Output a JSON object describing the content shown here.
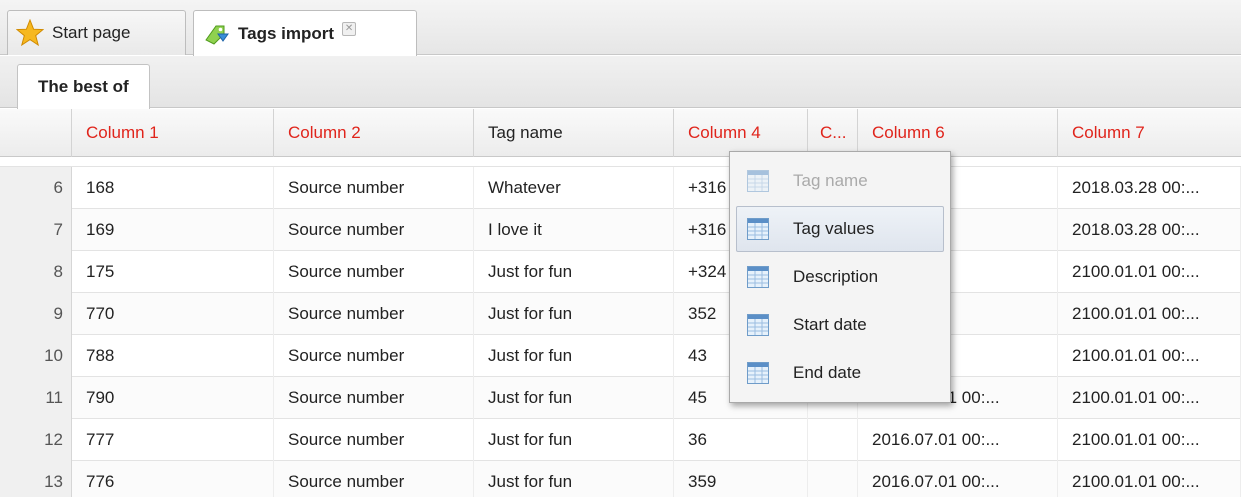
{
  "tabs": [
    {
      "label": "Start page",
      "icon": "star-icon",
      "active": false
    },
    {
      "label": "Tags import",
      "icon": "tags-import-icon",
      "active": true,
      "closable": true
    }
  ],
  "subtab": {
    "label": "The best of"
  },
  "grid": {
    "columns": [
      "",
      "Column 1",
      "Column 2",
      "Tag name",
      "Column 4",
      "C...",
      "Column 6",
      "Column 7"
    ],
    "column_colors": {
      "mapped": "#222222",
      "unmapped": "#e0241b"
    },
    "rows": [
      [
        "6",
        "168",
        "Source number",
        "Whatever",
        "+316",
        "",
        ".01 00:...",
        "2018.03.28 00:..."
      ],
      [
        "7",
        "169",
        "Source number",
        "I love it",
        "+316",
        "",
        ".01 00:...",
        "2018.03.28 00:..."
      ],
      [
        "8",
        "175",
        "Source number",
        "Just for fun",
        "+324",
        "",
        ".01 00:...",
        "2100.01.01 00:..."
      ],
      [
        "9",
        "770",
        "Source number",
        "Just for fun",
        "352",
        "",
        ".01 00:...",
        "2100.01.01 00:..."
      ],
      [
        "10",
        "788",
        "Source number",
        "Just for fun",
        "43",
        "",
        ".01 00:...",
        "2100.01.01 00:..."
      ],
      [
        "11",
        "790",
        "Source number",
        "Just for fun",
        "45",
        "",
        "2016.07.01 00:...",
        "2100.01.01 00:..."
      ],
      [
        "12",
        "777",
        "Source number",
        "Just for fun",
        "36",
        "",
        "2016.07.01 00:...",
        "2100.01.01 00:..."
      ],
      [
        "13",
        "776",
        "Source number",
        "Just for fun",
        "359",
        "",
        "2016.07.01 00:...",
        "2100.01.01 00:..."
      ]
    ]
  },
  "context_menu": {
    "items": [
      {
        "label": "Tag name",
        "icon": "column-icon",
        "disabled": true
      },
      {
        "label": "Tag values",
        "icon": "column-icon",
        "hover": true
      },
      {
        "label": "Description",
        "icon": "column-icon"
      },
      {
        "label": "Start date",
        "icon": "column-icon"
      },
      {
        "label": "End date",
        "icon": "column-icon"
      }
    ]
  }
}
